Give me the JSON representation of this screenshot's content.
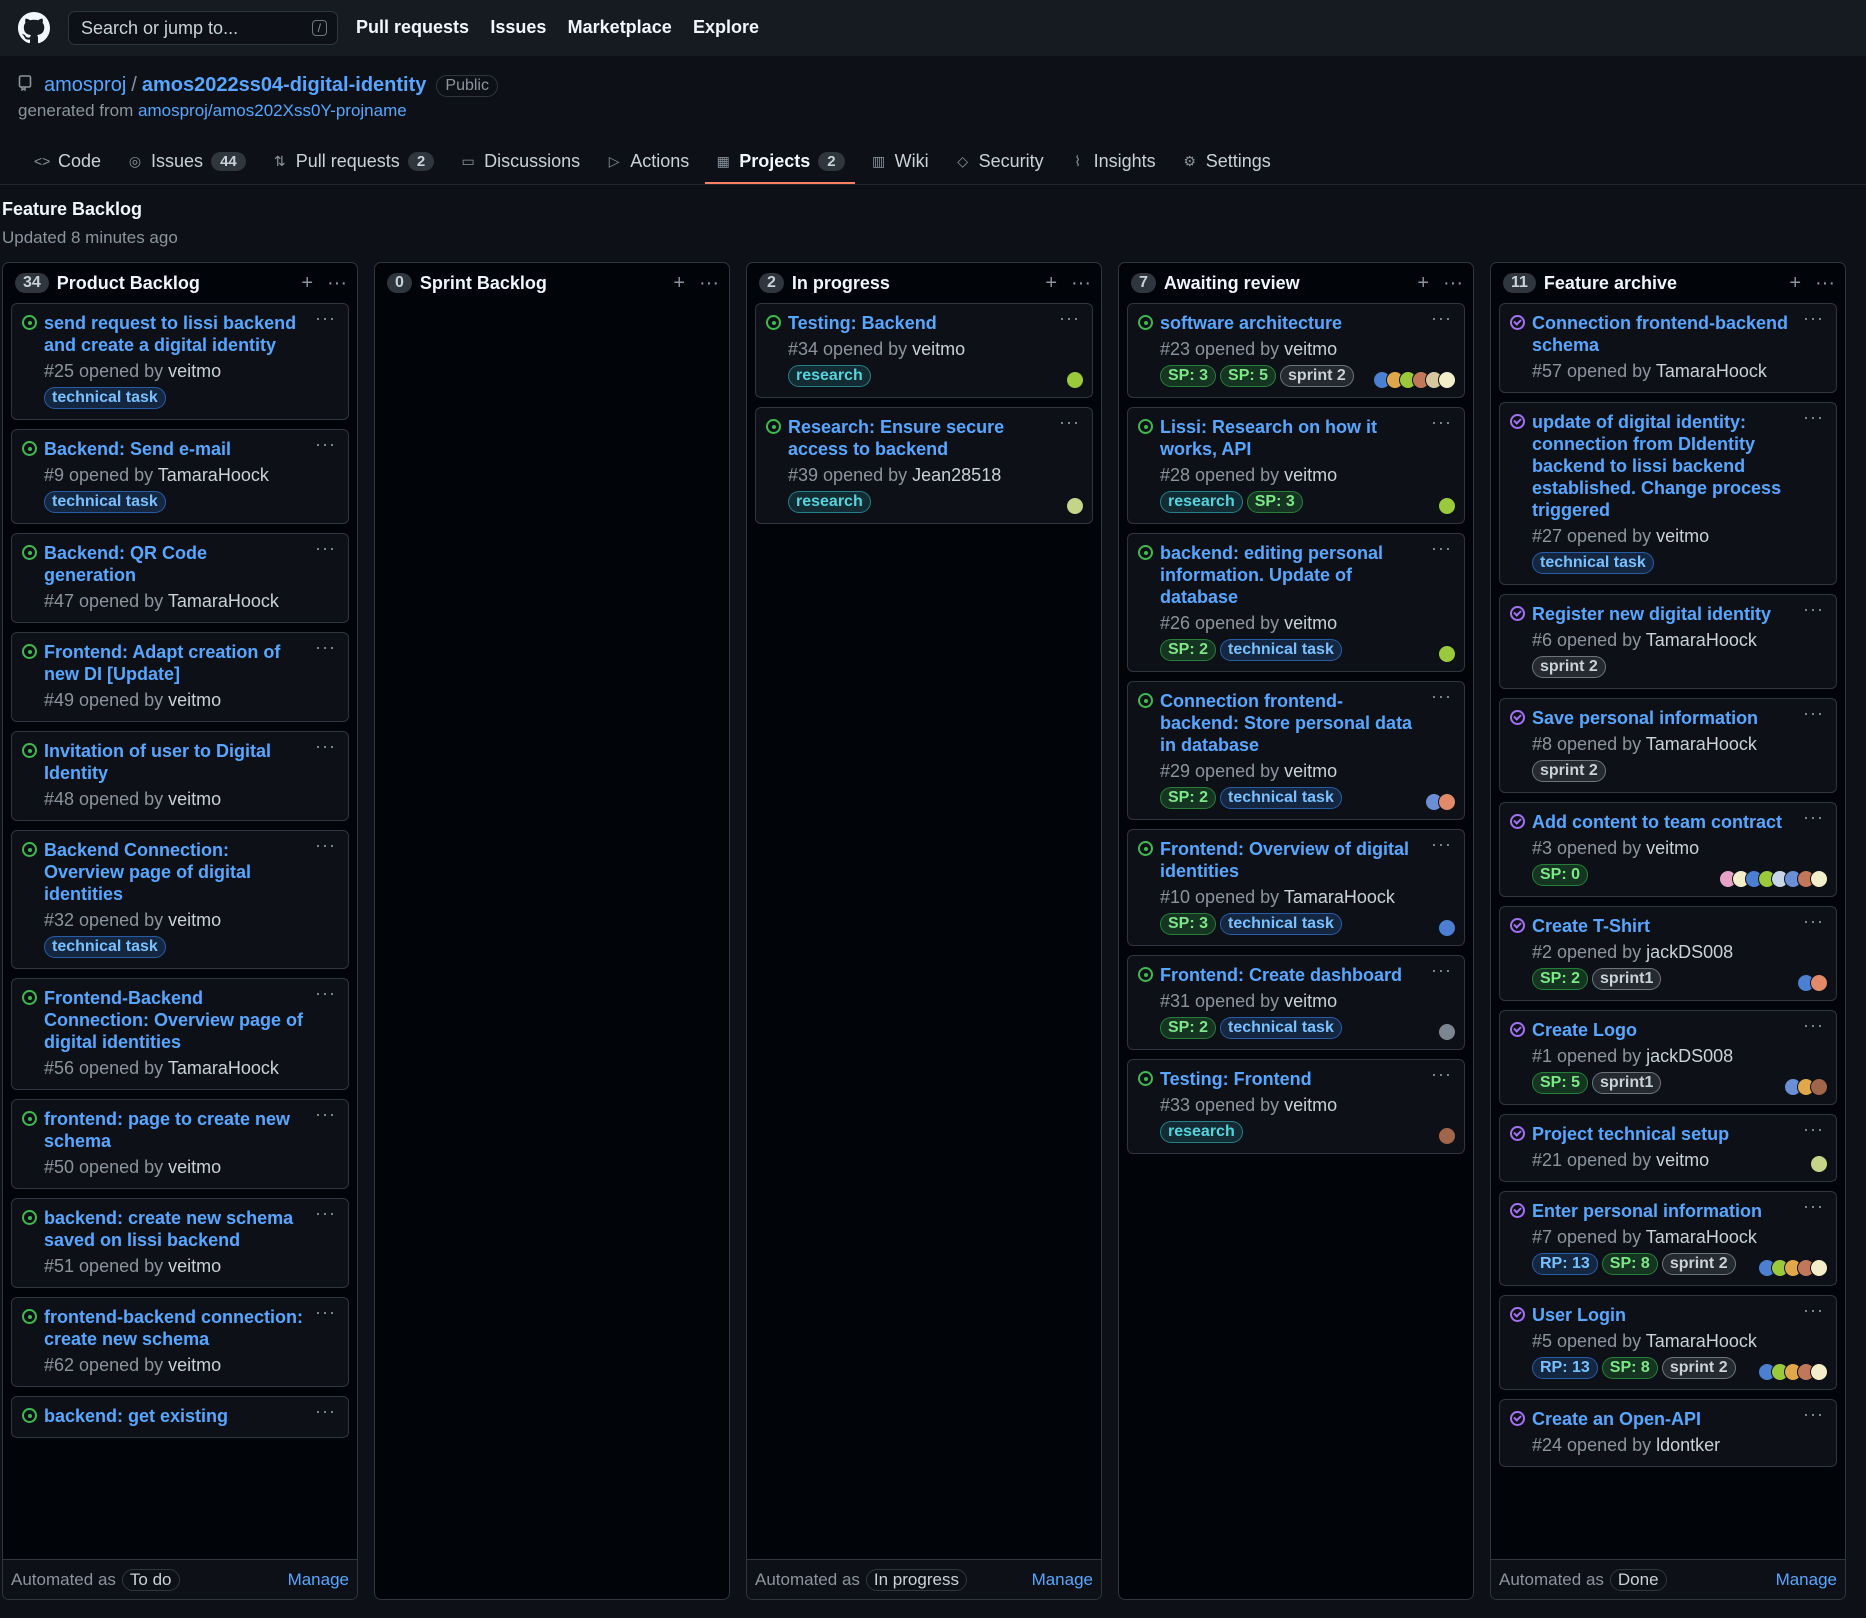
{
  "search": {
    "placeholder": "Search or jump to...",
    "shortcut": "/"
  },
  "topnav": [
    "Pull requests",
    "Issues",
    "Marketplace",
    "Explore"
  ],
  "repo": {
    "owner": "amosproj",
    "name": "amos2022ss04-digital-identity",
    "visibility": "Public",
    "generated_prefix": "generated from",
    "generated_from": "amosproj/amos202Xss0Y-projname"
  },
  "tabs": [
    {
      "label": "Code",
      "count": null,
      "icon": "code-icon",
      "active": false
    },
    {
      "label": "Issues",
      "count": "44",
      "icon": "issue-icon",
      "active": false
    },
    {
      "label": "Pull requests",
      "count": "2",
      "icon": "pull-request-icon",
      "active": false
    },
    {
      "label": "Discussions",
      "count": null,
      "icon": "discussion-icon",
      "active": false
    },
    {
      "label": "Actions",
      "count": null,
      "icon": "play-icon",
      "active": false
    },
    {
      "label": "Projects",
      "count": "2",
      "icon": "project-icon",
      "active": true
    },
    {
      "label": "Wiki",
      "count": null,
      "icon": "book-icon",
      "active": false
    },
    {
      "label": "Security",
      "count": null,
      "icon": "shield-icon",
      "active": false
    },
    {
      "label": "Insights",
      "count": null,
      "icon": "graph-icon",
      "active": false
    },
    {
      "label": "Settings",
      "count": null,
      "icon": "gear-icon",
      "active": false
    }
  ],
  "project": {
    "title": "Feature Backlog",
    "updated": "Updated 8 minutes ago"
  },
  "colors": {
    "label_blue": "#79c0ff",
    "label_teal": "#56d4dd",
    "label_green": "#7ee787",
    "label_gray": "#c9d1d9",
    "accent": "#f78166",
    "link": "#58a6ff"
  },
  "columns": [
    {
      "count": "34",
      "name": "Product Backlog",
      "footer": {
        "prefix": "Automated as",
        "badge": "To do",
        "manage": "Manage"
      },
      "cards": [
        {
          "title": "send request to lissi backend and create a digital identity",
          "number": "#25",
          "opened": "opened by",
          "author": "veitmo",
          "labels": [
            {
              "text": "technical task",
              "color": "blue"
            }
          ],
          "avatars": [],
          "state": "open"
        },
        {
          "title": "Backend: Send e-mail",
          "number": "#9",
          "opened": "opened by",
          "author": "TamaraHoock",
          "labels": [
            {
              "text": "technical task",
              "color": "blue"
            }
          ],
          "avatars": [],
          "state": "open"
        },
        {
          "title": "Backend: QR Code generation",
          "number": "#47",
          "opened": "opened by",
          "author": "TamaraHoock",
          "labels": [],
          "avatars": [],
          "state": "open"
        },
        {
          "title": "Frontend: Adapt creation of new DI [Update]",
          "number": "#49",
          "opened": "opened by",
          "author": "veitmo",
          "labels": [],
          "avatars": [],
          "state": "open"
        },
        {
          "title": "Invitation of user to Digital Identity",
          "number": "#48",
          "opened": "opened by",
          "author": "veitmo",
          "labels": [],
          "avatars": [],
          "state": "open"
        },
        {
          "title": "Backend Connection: Overview page of digital identities",
          "number": "#32",
          "opened": "opened by",
          "author": "veitmo",
          "labels": [
            {
              "text": "technical task",
              "color": "blue"
            }
          ],
          "avatars": [],
          "state": "open"
        },
        {
          "title": "Frontend-Backend Connection: Overview page of digital identities",
          "number": "#56",
          "opened": "opened by",
          "author": "TamaraHoock",
          "labels": [],
          "avatars": [],
          "state": "open"
        },
        {
          "title": "frontend: page to create new schema",
          "number": "#50",
          "opened": "opened by",
          "author": "veitmo",
          "labels": [],
          "avatars": [],
          "state": "open"
        },
        {
          "title": "backend: create new schema saved on lissi backend",
          "number": "#51",
          "opened": "opened by",
          "author": "veitmo",
          "labels": [],
          "avatars": [],
          "state": "open"
        },
        {
          "title": "frontend-backend connection: create new schema",
          "number": "#62",
          "opened": "opened by",
          "author": "veitmo",
          "labels": [],
          "avatars": [],
          "state": "open"
        },
        {
          "title": "backend: get existing",
          "number": "",
          "opened": "",
          "author": "",
          "labels": [],
          "avatars": [],
          "state": "open"
        }
      ]
    },
    {
      "count": "0",
      "name": "Sprint Backlog",
      "footer": null,
      "cards": []
    },
    {
      "count": "2",
      "name": "In progress",
      "footer": {
        "prefix": "Automated as",
        "badge": "In progress",
        "manage": "Manage"
      },
      "cards": [
        {
          "title": "Testing: Backend",
          "number": "#34",
          "opened": "opened by",
          "author": "veitmo",
          "labels": [
            {
              "text": "research",
              "color": "teal"
            }
          ],
          "avatars": [
            "#9ac93b"
          ],
          "state": "open"
        },
        {
          "title": "Research: Ensure secure access to backend",
          "number": "#39",
          "opened": "opened by",
          "author": "Jean28518",
          "labels": [
            {
              "text": "research",
              "color": "teal"
            }
          ],
          "avatars": [
            "#c6d48a"
          ],
          "state": "open"
        }
      ]
    },
    {
      "count": "7",
      "name": "Awaiting review",
      "footer": null,
      "cards": [
        {
          "title": "software architecture",
          "number": "#23",
          "opened": "opened by",
          "author": "veitmo",
          "labels": [
            {
              "text": "SP: 3",
              "color": "green"
            },
            {
              "text": "SP: 5",
              "color": "green"
            },
            {
              "text": "sprint 2",
              "color": "gray"
            }
          ],
          "avatars": [
            "#4a7fd1",
            "#e0a84a",
            "#9ac93b",
            "#c1775a",
            "#d6c7a1",
            "#f2eec9"
          ],
          "state": "open"
        },
        {
          "title": "Lissi: Research on how it works, API",
          "number": "#28",
          "opened": "opened by",
          "author": "veitmo",
          "labels": [
            {
              "text": "research",
              "color": "teal"
            },
            {
              "text": "SP: 3",
              "color": "green"
            }
          ],
          "avatars": [
            "#9ac93b"
          ],
          "state": "open"
        },
        {
          "title": "backend: editing personal information. Update of database",
          "number": "#26",
          "opened": "opened by",
          "author": "veitmo",
          "labels": [
            {
              "text": "SP: 2",
              "color": "green"
            },
            {
              "text": "technical task",
              "color": "blue"
            }
          ],
          "avatars": [
            "#9ac93b"
          ],
          "state": "open"
        },
        {
          "title": "Connection frontend-backend: Store personal data in database",
          "number": "#29",
          "opened": "opened by",
          "author": "veitmo",
          "labels": [
            {
              "text": "SP: 2",
              "color": "green"
            },
            {
              "text": "technical task",
              "color": "blue"
            }
          ],
          "avatars": [
            "#6b8fd6",
            "#e08a6a"
          ],
          "state": "open"
        },
        {
          "title": "Frontend: Overview of digital identities",
          "number": "#10",
          "opened": "opened by",
          "author": "TamaraHoock",
          "labels": [
            {
              "text": "SP: 3",
              "color": "green"
            },
            {
              "text": "technical task",
              "color": "blue"
            }
          ],
          "avatars": [
            "#4a7fd1"
          ],
          "state": "open"
        },
        {
          "title": "Frontend: Create dashboard",
          "number": "#31",
          "opened": "opened by",
          "author": "veitmo",
          "labels": [
            {
              "text": "SP: 2",
              "color": "green"
            },
            {
              "text": "technical task",
              "color": "blue"
            }
          ],
          "avatars": [
            "#7d8590"
          ],
          "state": "open"
        },
        {
          "title": "Testing: Frontend",
          "number": "#33",
          "opened": "opened by",
          "author": "veitmo",
          "labels": [
            {
              "text": "research",
              "color": "teal"
            }
          ],
          "avatars": [
            "#a0654a"
          ],
          "state": "open"
        }
      ]
    },
    {
      "count": "11",
      "name": "Feature archive",
      "footer": {
        "prefix": "Automated as",
        "badge": "Done",
        "manage": "Manage"
      },
      "cards": [
        {
          "title": "Connection frontend-backend schema",
          "number": "#57",
          "opened": "opened by",
          "author": "TamaraHoock",
          "labels": [],
          "avatars": [],
          "state": "closed"
        },
        {
          "title": "update of digital identity: connection from DIdentity backend to lissi backend established. Change process triggered",
          "number": "#27",
          "opened": "opened by",
          "author": "veitmo",
          "labels": [
            {
              "text": "technical task",
              "color": "blue"
            }
          ],
          "avatars": [],
          "state": "closed"
        },
        {
          "title": "Register new digital identity",
          "number": "#6",
          "opened": "opened by",
          "author": "TamaraHoock",
          "labels": [
            {
              "text": "sprint 2",
              "color": "gray"
            }
          ],
          "avatars": [],
          "state": "closed"
        },
        {
          "title": "Save personal information",
          "number": "#8",
          "opened": "opened by",
          "author": "TamaraHoock",
          "labels": [
            {
              "text": "sprint 2",
              "color": "gray"
            }
          ],
          "avatars": [],
          "state": "closed"
        },
        {
          "title": "Add content to team contract",
          "number": "#3",
          "opened": "opened by",
          "author": "veitmo",
          "labels": [
            {
              "text": "SP: 0",
              "color": "green"
            }
          ],
          "avatars": [
            "#e6a3c8",
            "#f2eec9",
            "#4a7fd1",
            "#9ac93b",
            "#c6d6e8",
            "#6b8fd6",
            "#c1775a",
            "#f2eec9"
          ],
          "state": "closed"
        },
        {
          "title": "Create T-Shirt",
          "number": "#2",
          "opened": "opened by",
          "author": "jackDS008",
          "labels": [
            {
              "text": "SP: 2",
              "color": "green"
            },
            {
              "text": "sprint1",
              "color": "gray"
            }
          ],
          "avatars": [
            "#4a7fd1",
            "#e08a6a"
          ],
          "state": "closed"
        },
        {
          "title": "Create Logo",
          "number": "#1",
          "opened": "opened by",
          "author": "jackDS008",
          "labels": [
            {
              "text": "SP: 5",
              "color": "green"
            },
            {
              "text": "sprint1",
              "color": "gray"
            }
          ],
          "avatars": [
            "#6b8fd6",
            "#e0a84a",
            "#a0654a"
          ],
          "state": "closed"
        },
        {
          "title": "Project technical setup",
          "number": "#21",
          "opened": "opened by",
          "author": "veitmo",
          "labels": [],
          "avatars": [
            "#c6d48a"
          ],
          "state": "closed"
        },
        {
          "title": "Enter personal information",
          "number": "#7",
          "opened": "opened by",
          "author": "TamaraHoock",
          "labels": [
            {
              "text": "RP: 13",
              "color": "blue"
            },
            {
              "text": "SP: 8",
              "color": "green"
            },
            {
              "text": "sprint 2",
              "color": "gray"
            }
          ],
          "avatars": [
            "#4a7fd1",
            "#9ac93b",
            "#e0a84a",
            "#c1775a",
            "#f2eec9"
          ],
          "state": "closed"
        },
        {
          "title": "User Login",
          "number": "#5",
          "opened": "opened by",
          "author": "TamaraHoock",
          "labels": [
            {
              "text": "RP: 13",
              "color": "blue"
            },
            {
              "text": "SP: 8",
              "color": "green"
            },
            {
              "text": "sprint 2",
              "color": "gray"
            }
          ],
          "avatars": [
            "#4a7fd1",
            "#9ac93b",
            "#e0a84a",
            "#c1775a",
            "#f2eec9"
          ],
          "state": "closed"
        },
        {
          "title": "Create an Open-API",
          "number": "#24",
          "opened": "opened by",
          "author": "ldontker",
          "labels": [],
          "avatars": [],
          "state": "closed"
        }
      ]
    }
  ]
}
